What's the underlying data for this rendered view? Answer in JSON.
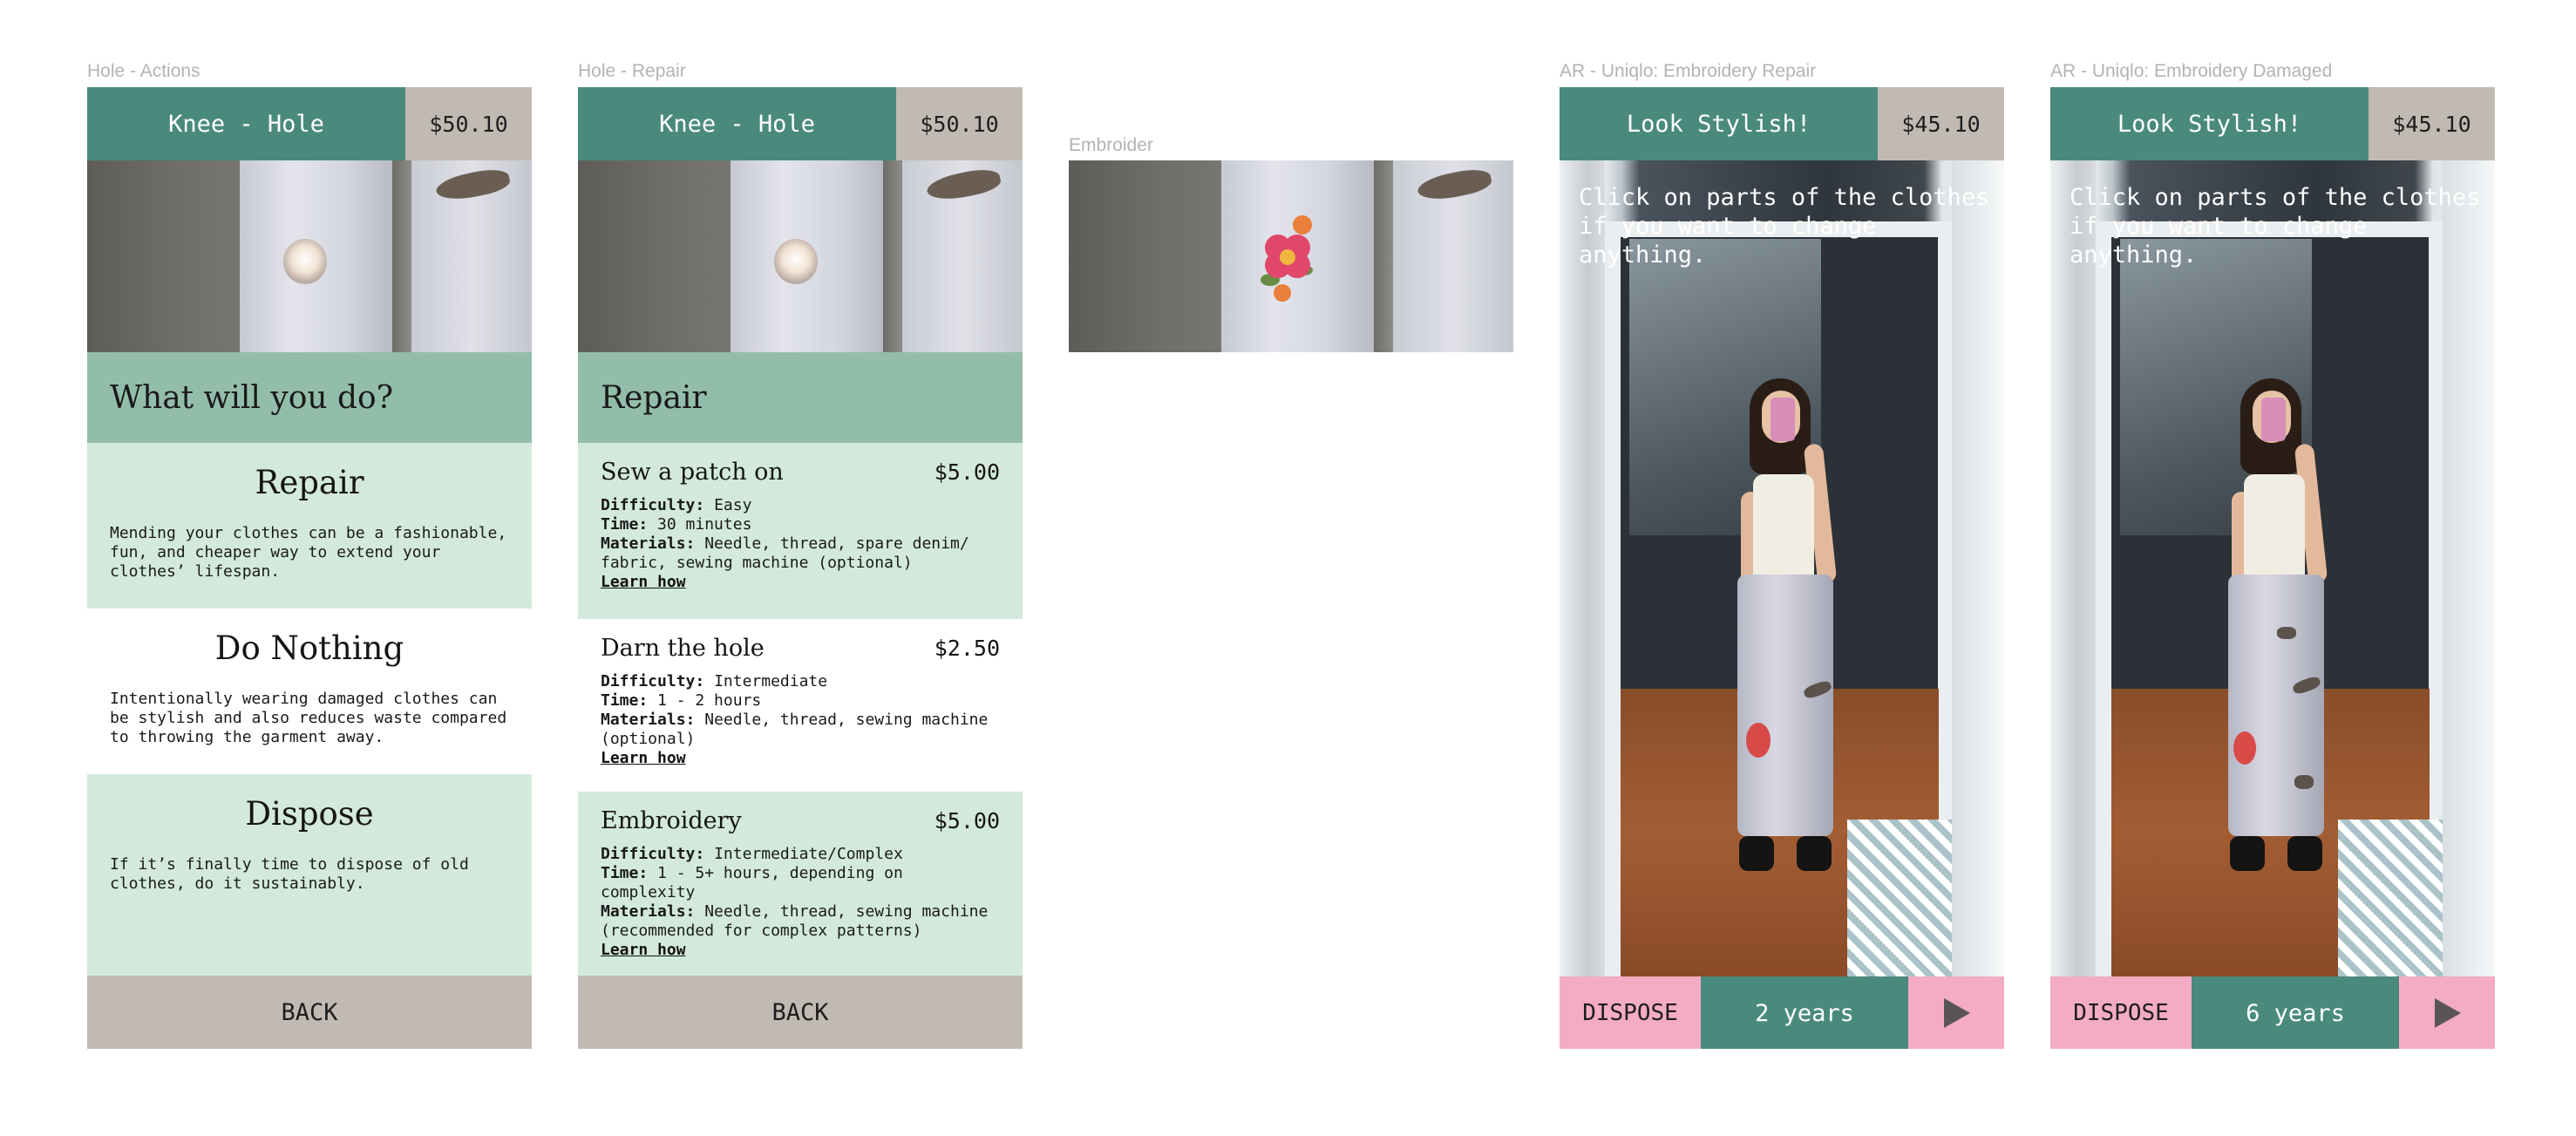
{
  "frames": {
    "actions": {
      "label": "Hole - Actions",
      "header_title": "Knee - Hole",
      "header_price": "$50.10",
      "question": "What will you do?",
      "options": [
        {
          "title": "Repair",
          "desc": "Mending your clothes can be a fashionable, fun, and cheaper way to extend your clothes’ lifespan."
        },
        {
          "title": "Do Nothing",
          "desc": "Intentionally wearing damaged clothes can be stylish and also reduces waste compared to throwing the garment away."
        },
        {
          "title": "Dispose",
          "desc": "If it’s finally time to dispose of old clothes, do it sustainably."
        }
      ],
      "back_label": "BACK"
    },
    "repair": {
      "label": "Hole - Repair",
      "header_title": "Knee - Hole",
      "header_price": "$50.10",
      "heading": "Repair",
      "items": [
        {
          "name": "Sew a patch on",
          "price": "$5.00",
          "difficulty_key": "Difficulty:",
          "difficulty": "Easy",
          "time_key": "Time:",
          "time": "30 minutes",
          "materials_key": "Materials:",
          "materials": "Needle, thread, spare denim/ fabric, sewing machine (optional)",
          "learn": "Learn how"
        },
        {
          "name": "Darn the hole",
          "price": "$2.50",
          "difficulty_key": "Difficulty:",
          "difficulty": "Intermediate",
          "time_key": "Time:",
          "time": "1 - 2 hours",
          "materials_key": "Materials:",
          "materials": "Needle, thread, sewing machine (optional)",
          "learn": "Learn how"
        },
        {
          "name": "Embroidery",
          "price": "$5.00",
          "difficulty_key": "Difficulty:",
          "difficulty": "Intermediate/Complex",
          "time_key": "Time:",
          "time": "1 - 5+ hours, depending on complexity",
          "materials_key": "Materials:",
          "materials": "Needle, thread, sewing machine (recommended for complex patterns)",
          "learn": "Learn how"
        }
      ],
      "back_label": "BACK"
    },
    "embroider": {
      "label": "Embroider"
    },
    "ar_repair": {
      "label": "AR - Uniqlo: Embroidery Repair",
      "header_title": "Look Stylish!",
      "header_price": "$45.10",
      "hint": "Click on parts of the clothes if you want to change anything.",
      "dispose_label": "DISPOSE",
      "years": "2 years"
    },
    "ar_damaged": {
      "label": "AR - Uniqlo: Embroidery Damaged",
      "header_title": "Look Stylish!",
      "header_price": "$45.10",
      "hint": "Click on parts of the clothes if you want to change anything.",
      "dispose_label": "DISPOSE",
      "years": "6 years"
    }
  },
  "colors": {
    "teal": "#4a8a7d",
    "taupe": "#c1bab3",
    "mint_band": "#93bdab",
    "mint_light": "#d3e9dc",
    "pink": "#f4abc4"
  },
  "icons": {
    "play": "play-icon"
  }
}
